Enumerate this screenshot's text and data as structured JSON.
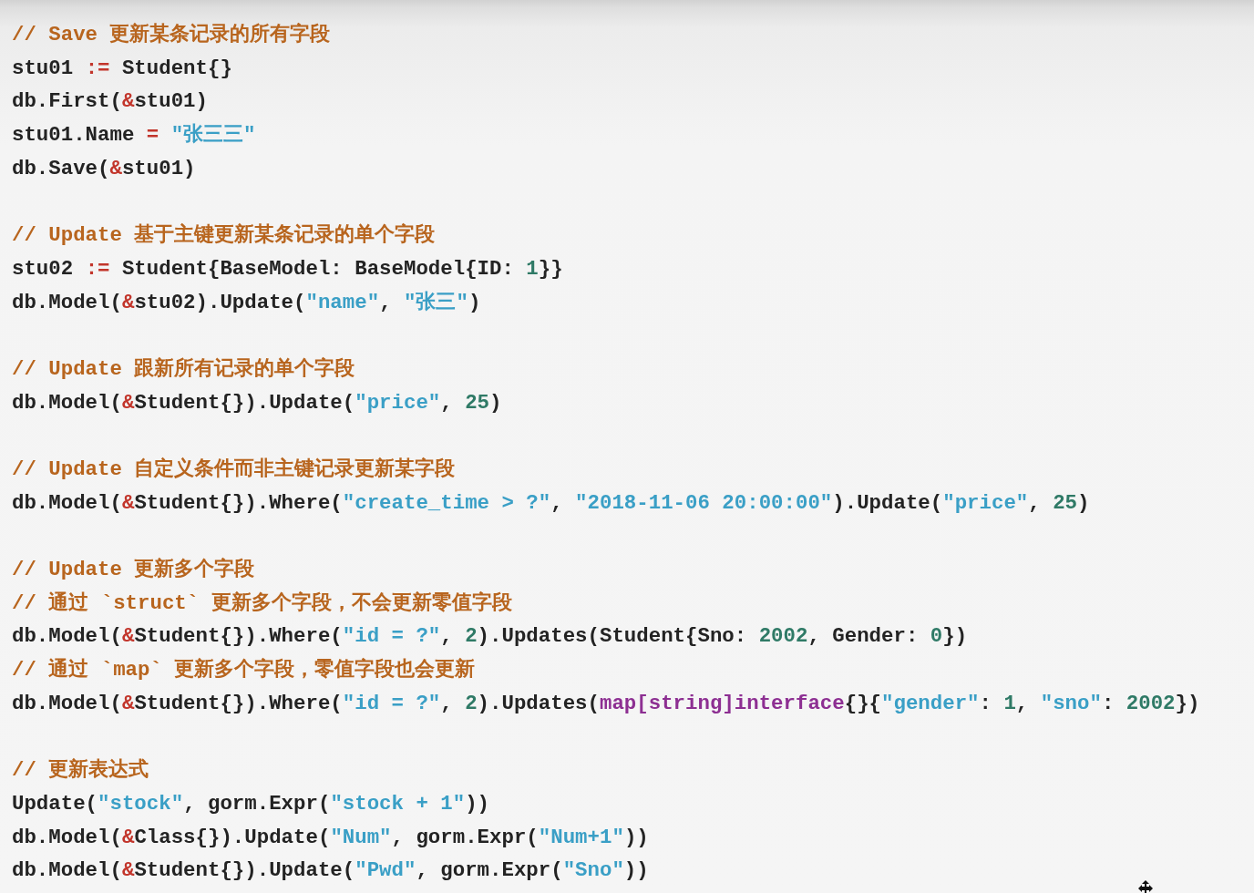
{
  "code_lines": [
    {
      "kind": "comment",
      "text": "// Save 更新某条记录的所有字段"
    },
    {
      "kind": "code",
      "tokens": [
        {
          "kind": "plain",
          "text": "stu01 "
        },
        {
          "kind": "op",
          "text": ":="
        },
        {
          "kind": "plain",
          "text": " Student{}"
        }
      ]
    },
    {
      "kind": "code",
      "tokens": [
        {
          "kind": "plain",
          "text": "db.First("
        },
        {
          "kind": "op",
          "text": "&"
        },
        {
          "kind": "plain",
          "text": "stu01)"
        }
      ]
    },
    {
      "kind": "code",
      "tokens": [
        {
          "kind": "plain",
          "text": "stu01.Name "
        },
        {
          "kind": "op",
          "text": "= "
        },
        {
          "kind": "string",
          "text": "\"张三三\""
        }
      ]
    },
    {
      "kind": "code",
      "tokens": [
        {
          "kind": "plain",
          "text": "db.Save("
        },
        {
          "kind": "op",
          "text": "&"
        },
        {
          "kind": "plain",
          "text": "stu01)"
        }
      ]
    },
    {
      "kind": "blank"
    },
    {
      "kind": "comment",
      "text": "// Update 基于主键更新某条记录的单个字段"
    },
    {
      "kind": "code",
      "tokens": [
        {
          "kind": "plain",
          "text": "stu02 "
        },
        {
          "kind": "op",
          "text": ":="
        },
        {
          "kind": "plain",
          "text": " Student{BaseModel: BaseModel{ID: "
        },
        {
          "kind": "number",
          "text": "1"
        },
        {
          "kind": "plain",
          "text": "}}"
        }
      ]
    },
    {
      "kind": "code",
      "tokens": [
        {
          "kind": "plain",
          "text": "db.Model("
        },
        {
          "kind": "op",
          "text": "&"
        },
        {
          "kind": "plain",
          "text": "stu02).Update("
        },
        {
          "kind": "string",
          "text": "\"name\""
        },
        {
          "kind": "plain",
          "text": ", "
        },
        {
          "kind": "string",
          "text": "\"张三\""
        },
        {
          "kind": "plain",
          "text": ")"
        }
      ]
    },
    {
      "kind": "blank"
    },
    {
      "kind": "comment",
      "text": "// Update 跟新所有记录的单个字段"
    },
    {
      "kind": "code",
      "tokens": [
        {
          "kind": "plain",
          "text": "db.Model("
        },
        {
          "kind": "op",
          "text": "&"
        },
        {
          "kind": "plain",
          "text": "Student{}).Update("
        },
        {
          "kind": "string",
          "text": "\"price\""
        },
        {
          "kind": "plain",
          "text": ", "
        },
        {
          "kind": "number",
          "text": "25"
        },
        {
          "kind": "plain",
          "text": ")"
        }
      ]
    },
    {
      "kind": "blank"
    },
    {
      "kind": "comment",
      "text": "// Update 自定义条件而非主键记录更新某字段"
    },
    {
      "kind": "code",
      "tokens": [
        {
          "kind": "plain",
          "text": "db.Model("
        },
        {
          "kind": "op",
          "text": "&"
        },
        {
          "kind": "plain",
          "text": "Student{}).Where("
        },
        {
          "kind": "string",
          "text": "\"create_time > ?\""
        },
        {
          "kind": "plain",
          "text": ", "
        },
        {
          "kind": "string",
          "text": "\"2018-11-06 20:00:00\""
        },
        {
          "kind": "plain",
          "text": ").Update("
        },
        {
          "kind": "string",
          "text": "\"price\""
        },
        {
          "kind": "plain",
          "text": ", "
        },
        {
          "kind": "number",
          "text": "25"
        },
        {
          "kind": "plain",
          "text": ")"
        }
      ]
    },
    {
      "kind": "blank"
    },
    {
      "kind": "comment",
      "text": "// Update 更新多个字段"
    },
    {
      "kind": "comment",
      "text": "// 通过 `struct` 更新多个字段，不会更新零值字段"
    },
    {
      "kind": "code",
      "tokens": [
        {
          "kind": "plain",
          "text": "db.Model("
        },
        {
          "kind": "op",
          "text": "&"
        },
        {
          "kind": "plain",
          "text": "Student{}).Where("
        },
        {
          "kind": "string",
          "text": "\"id = ?\""
        },
        {
          "kind": "plain",
          "text": ", "
        },
        {
          "kind": "number",
          "text": "2"
        },
        {
          "kind": "plain",
          "text": ").Updates(Student{Sno: "
        },
        {
          "kind": "number",
          "text": "2002"
        },
        {
          "kind": "plain",
          "text": ", Gender: "
        },
        {
          "kind": "number",
          "text": "0"
        },
        {
          "kind": "plain",
          "text": "})"
        }
      ]
    },
    {
      "kind": "comment",
      "text": "// 通过 `map` 更新多个字段，零值字段也会更新"
    },
    {
      "kind": "code",
      "tokens": [
        {
          "kind": "plain",
          "text": "db.Model("
        },
        {
          "kind": "op",
          "text": "&"
        },
        {
          "kind": "plain",
          "text": "Student{}).Where("
        },
        {
          "kind": "string",
          "text": "\"id = ?\""
        },
        {
          "kind": "plain",
          "text": ", "
        },
        {
          "kind": "number",
          "text": "2"
        },
        {
          "kind": "plain",
          "text": ").Updates("
        },
        {
          "kind": "keyword",
          "text": "map[string]interface"
        },
        {
          "kind": "plain",
          "text": "{}{"
        },
        {
          "kind": "string",
          "text": "\"gender\""
        },
        {
          "kind": "plain",
          "text": ": "
        },
        {
          "kind": "number",
          "text": "1"
        },
        {
          "kind": "plain",
          "text": ", "
        },
        {
          "kind": "string",
          "text": "\"sno\""
        },
        {
          "kind": "plain",
          "text": ": "
        },
        {
          "kind": "number",
          "text": "2002"
        },
        {
          "kind": "plain",
          "text": "})"
        }
      ]
    },
    {
      "kind": "blank"
    },
    {
      "kind": "comment",
      "text": "// 更新表达式"
    },
    {
      "kind": "code",
      "tokens": [
        {
          "kind": "plain",
          "text": "Update("
        },
        {
          "kind": "string",
          "text": "\"stock\""
        },
        {
          "kind": "plain",
          "text": ", gorm.Expr("
        },
        {
          "kind": "string",
          "text": "\"stock + 1\""
        },
        {
          "kind": "plain",
          "text": "))"
        }
      ]
    },
    {
      "kind": "code",
      "tokens": [
        {
          "kind": "plain",
          "text": "db.Model("
        },
        {
          "kind": "op",
          "text": "&"
        },
        {
          "kind": "plain",
          "text": "Class{}).Update("
        },
        {
          "kind": "string",
          "text": "\"Num\""
        },
        {
          "kind": "plain",
          "text": ", gorm.Expr("
        },
        {
          "kind": "string",
          "text": "\"Num+1\""
        },
        {
          "kind": "plain",
          "text": "))"
        }
      ]
    },
    {
      "kind": "code",
      "tokens": [
        {
          "kind": "plain",
          "text": "db.Model("
        },
        {
          "kind": "op",
          "text": "&"
        },
        {
          "kind": "plain",
          "text": "Student{}).Update("
        },
        {
          "kind": "string",
          "text": "\"Pwd\""
        },
        {
          "kind": "plain",
          "text": ", gorm.Expr("
        },
        {
          "kind": "string",
          "text": "\"Sno\""
        },
        {
          "kind": "plain",
          "text": "))"
        }
      ]
    }
  ]
}
